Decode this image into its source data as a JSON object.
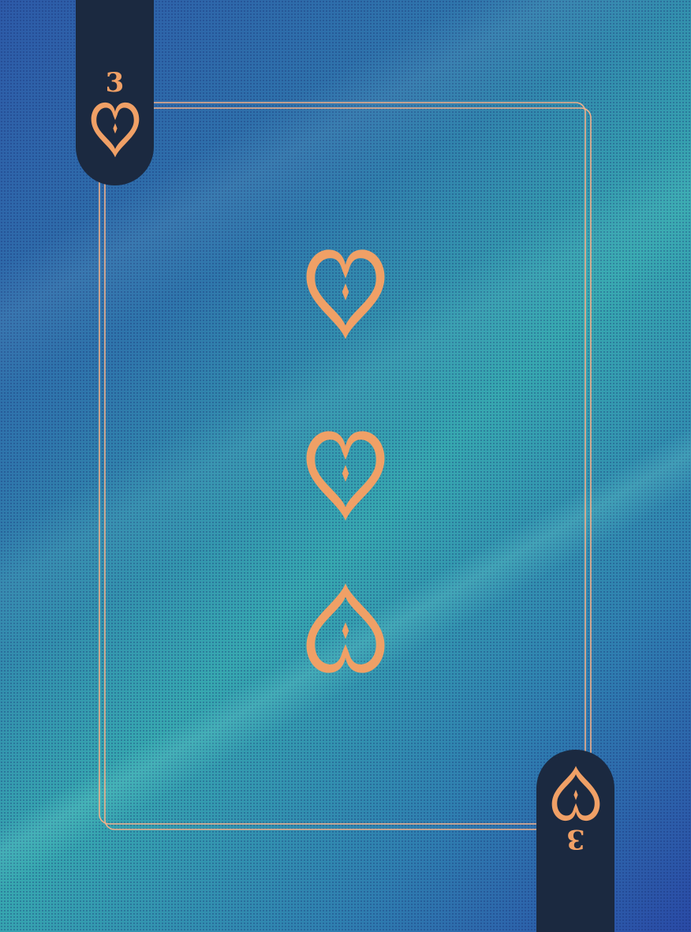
{
  "card": {
    "rank": "3",
    "suit": "hearts",
    "suit_icon": "heart-icon",
    "pip_count": 3,
    "colors": {
      "background_top": "#2d5aa8",
      "background_mid": "#37a8b0",
      "corner_tab": "#1b2940",
      "ink": "#f0a066",
      "frame_line": "#f2b08a"
    }
  }
}
